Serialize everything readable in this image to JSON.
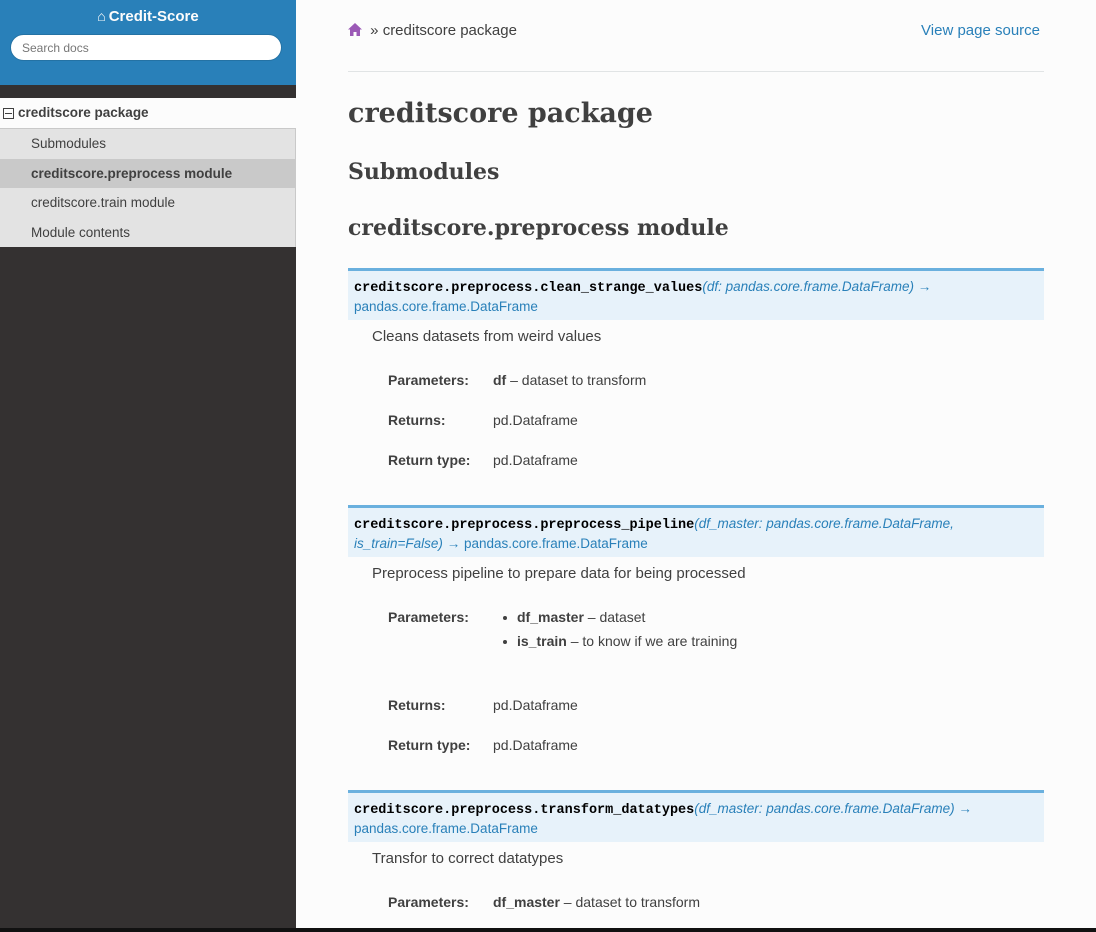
{
  "sidebar": {
    "project_name": "Credit-Score",
    "search_placeholder": "Search docs",
    "toc_root": "creditscore package",
    "toc_items": [
      {
        "label": "Submodules"
      },
      {
        "label": "creditscore.preprocess module"
      },
      {
        "label": "creditscore.train module"
      },
      {
        "label": "Module contents"
      }
    ]
  },
  "breadcrumbs": {
    "separator": "»",
    "current": "creditscore package",
    "view_source": "View page source"
  },
  "content": {
    "title": "creditscore package",
    "h_submodules": "Submodules",
    "h_preprocess": "creditscore.preprocess module",
    "functions": [
      {
        "name": "creditscore.preprocess.clean_strange_values",
        "params": "df: pandas.core.frame.DataFrame",
        "ret_arrow": "→",
        "return_type": "pandas.core.frame.DataFrame",
        "description": "Cleans datasets from weird values",
        "param_label": "Parameters:",
        "param_name": "df",
        "param_desc": " – dataset to transform",
        "returns_label": "Returns:",
        "returns": "pd.Dataframe",
        "return_type_label": "Return type:",
        "return_type_value": "pd.Dataframe"
      },
      {
        "name": "creditscore.preprocess.preprocess_pipeline",
        "params_line1": "df_master: pandas.core.frame.DataFrame,",
        "params_line2": "is_train=False",
        "ret_arrow": "→",
        "return_type": "pandas.core.frame.DataFrame",
        "description": "Preprocess pipeline to prepare data for being processed",
        "param_label": "Parameters:",
        "param_items": [
          {
            "name": "df_master",
            "desc": " – dataset"
          },
          {
            "name": "is_train",
            "desc": " – to know if we are training"
          }
        ],
        "returns_label": "Returns:",
        "returns": "pd.Dataframe",
        "return_type_label": "Return type:",
        "return_type_value": "pd.Dataframe"
      },
      {
        "name": "creditscore.preprocess.transform_datatypes",
        "params": "df_master: pandas.core.frame.DataFrame",
        "ret_arrow": "→",
        "return_type": "pandas.core.frame.DataFrame",
        "description": "Transfor to correct datatypes",
        "param_label": "Parameters:",
        "param_name": "df_master",
        "param_desc": " – dataset to transform"
      }
    ]
  },
  "colors": {
    "sidebar_bg": "#343131",
    "header_blue": "#2980b9",
    "signature_bg": "#e7f2fa",
    "signature_border": "#6ab0de",
    "home_icon": "#9b59b6"
  },
  "icons": {
    "home": "home-icon",
    "toggle": "minus-square-icon"
  }
}
